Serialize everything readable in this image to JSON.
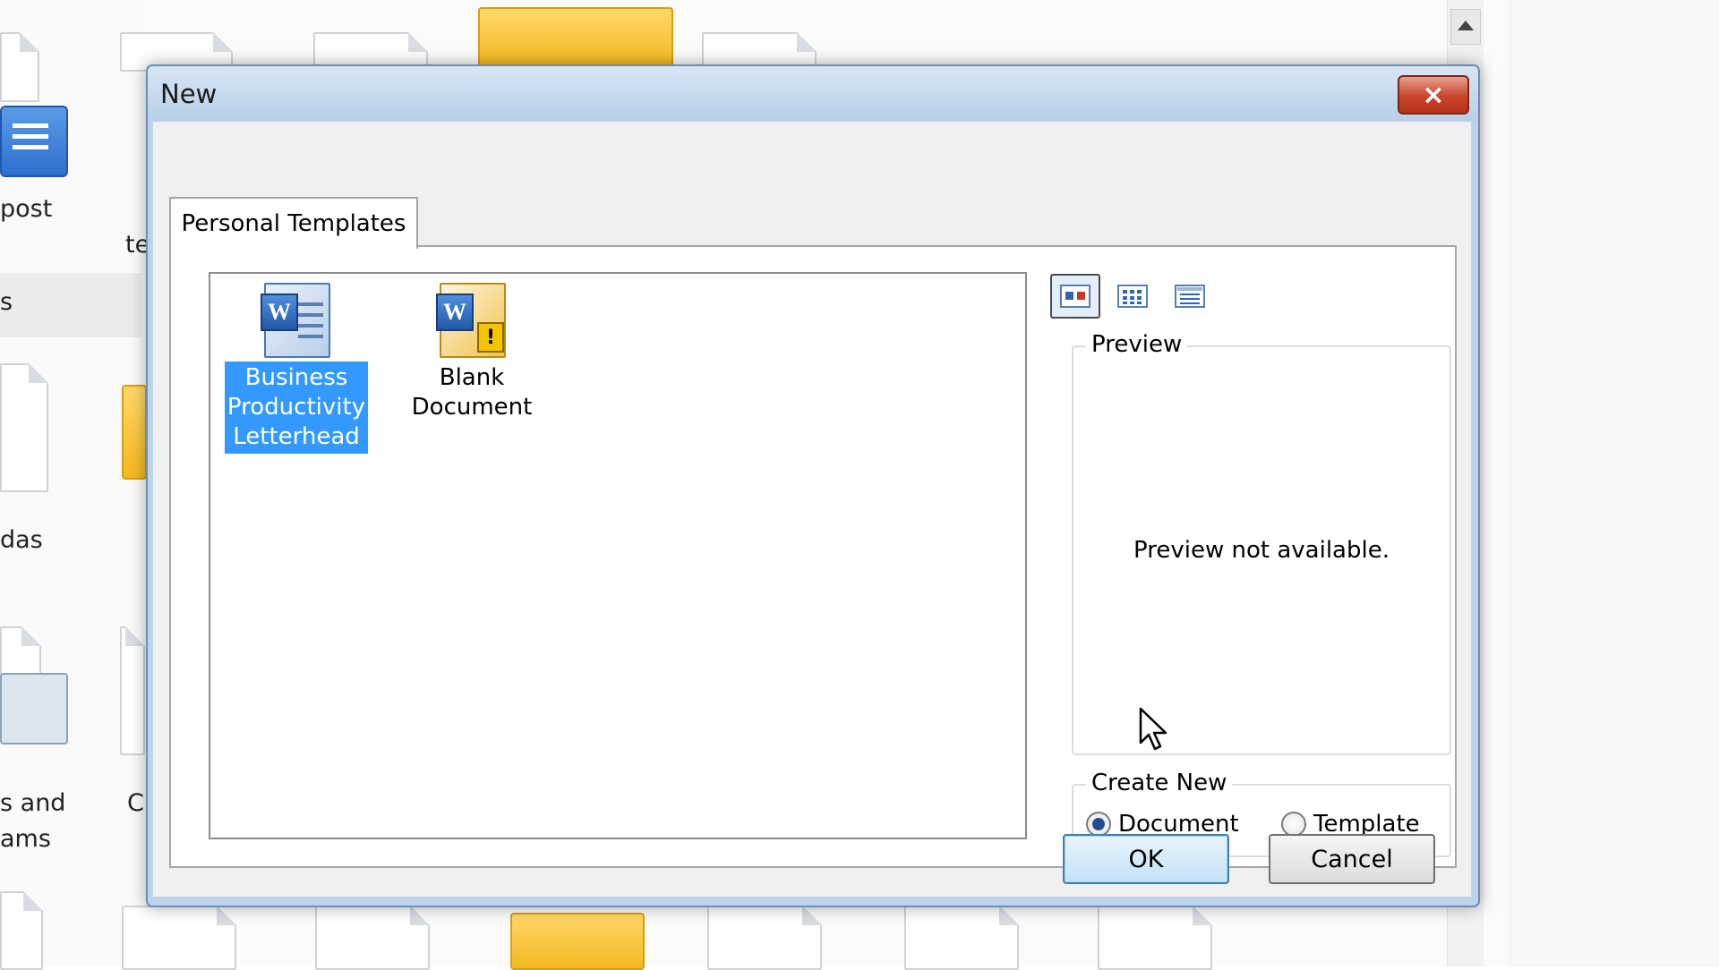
{
  "background_window": {
    "labels": [
      "post",
      "te",
      "s",
      "das",
      "s and",
      "ams",
      "C"
    ]
  },
  "dialog": {
    "title": "New",
    "close_icon": "×",
    "tab_label": "Personal Templates",
    "templates": [
      {
        "label": "Business Productivity Letterhead",
        "icon": "word-template-icon",
        "selected": true
      },
      {
        "label": "Blank Document",
        "icon": "word-blank-document-icon",
        "selected": false
      }
    ],
    "view_modes": [
      "large-icons",
      "list",
      "details"
    ],
    "preview": {
      "legend": "Preview",
      "message": "Preview not available."
    },
    "create_new": {
      "legend": "Create New",
      "options": [
        {
          "label": "Document",
          "checked": true
        },
        {
          "label": "Template",
          "checked": false
        }
      ]
    },
    "buttons": {
      "ok": "OK",
      "cancel": "Cancel"
    }
  },
  "colors": {
    "selection": "#3399ff",
    "titlebar": "#c9dcef",
    "close_button": "#c8452c"
  }
}
